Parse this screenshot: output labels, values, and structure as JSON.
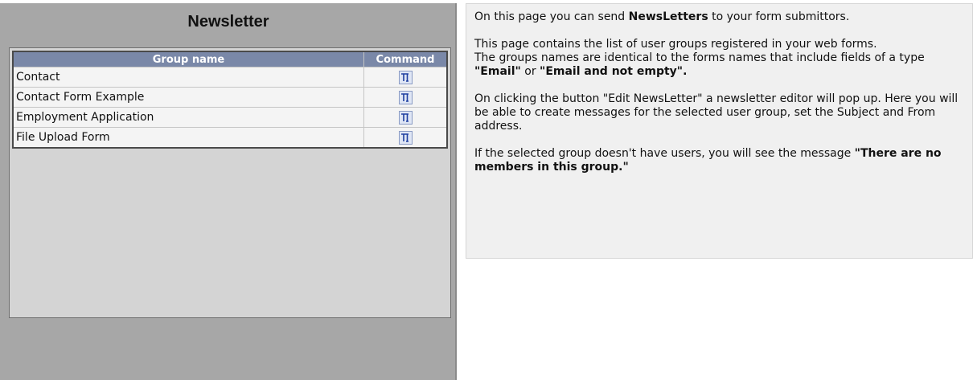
{
  "newsletter_panel": {
    "title": "Newsletter",
    "table": {
      "columns": [
        "Group name",
        "Command"
      ],
      "rows": [
        {
          "name": "Contact"
        },
        {
          "name": "Contact Form Example"
        },
        {
          "name": "Employment Application"
        },
        {
          "name": "File Upload Form"
        }
      ]
    },
    "command_icon": "edit-newsletter-icon"
  },
  "info": {
    "p1": {
      "pre": "On this page you can send ",
      "bold": "NewsLetters",
      "post": " to your form submittors."
    },
    "p2": {
      "line1": "This page contains the list of user groups registered in your web forms.",
      "line2_pre": "The groups names are identical to the forms names that include fields of a type ",
      "bold1": "\"Email\"",
      "mid": " or ",
      "bold2": "\"Email and not empty\"."
    },
    "p3": "On clicking the button \"Edit NewsLetter\" a newsletter editor will pop up. Here you will be able to create messages for the selected user group, set the Subject and From address.",
    "p4": {
      "pre": "If the selected group doesn't have users, you will see the message ",
      "bold": "\"There are no members in this group.\""
    }
  },
  "colors": {
    "panel_bg": "#a7a7a7",
    "header_bg": "#7a88a8",
    "icon_blue": "#1f3fa0"
  }
}
